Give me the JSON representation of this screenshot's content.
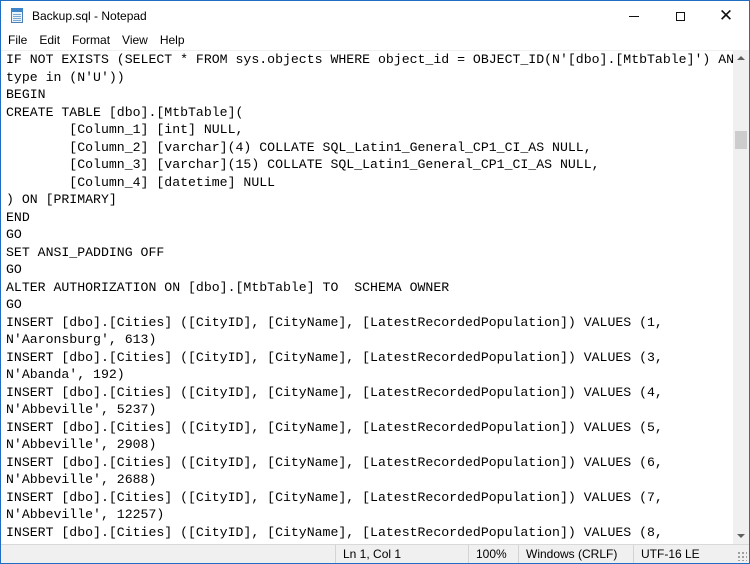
{
  "window": {
    "title": "Backup.sql - Notepad",
    "icon": "notepad-icon",
    "controls": {
      "minimize": "minimize-icon",
      "maximize": "maximize-icon",
      "close": "close-icon"
    }
  },
  "menu": [
    "File",
    "Edit",
    "Format",
    "View",
    "Help"
  ],
  "editor": {
    "lines": [
      "IF NOT EXISTS (SELECT * FROM sys.objects WHERE object_id = OBJECT_ID(N'[dbo].[MtbTable]') AND",
      "type in (N'U'))",
      "BEGIN",
      "CREATE TABLE [dbo].[MtbTable](",
      "        [Column_1] [int] NULL,",
      "        [Column_2] [varchar](4) COLLATE SQL_Latin1_General_CP1_CI_AS NULL,",
      "        [Column_3] [varchar](15) COLLATE SQL_Latin1_General_CP1_CI_AS NULL,",
      "        [Column_4] [datetime] NULL",
      ") ON [PRIMARY]",
      "END",
      "GO",
      "SET ANSI_PADDING OFF",
      "GO",
      "ALTER AUTHORIZATION ON [dbo].[MtbTable] TO  SCHEMA OWNER",
      "GO",
      "INSERT [dbo].[Cities] ([CityID], [CityName], [LatestRecordedPopulation]) VALUES (1,",
      "N'Aaronsburg', 613)",
      "INSERT [dbo].[Cities] ([CityID], [CityName], [LatestRecordedPopulation]) VALUES (3,",
      "N'Abanda', 192)",
      "INSERT [dbo].[Cities] ([CityID], [CityName], [LatestRecordedPopulation]) VALUES (4,",
      "N'Abbeville', 5237)",
      "INSERT [dbo].[Cities] ([CityID], [CityName], [LatestRecordedPopulation]) VALUES (5,",
      "N'Abbeville', 2908)",
      "INSERT [dbo].[Cities] ([CityID], [CityName], [LatestRecordedPopulation]) VALUES (6,",
      "N'Abbeville', 2688)",
      "INSERT [dbo].[Cities] ([CityID], [CityName], [LatestRecordedPopulation]) VALUES (7,",
      "N'Abbeville', 12257)",
      "INSERT [dbo].[Cities] ([CityID], [CityName], [LatestRecordedPopulation]) VALUES (8,"
    ]
  },
  "status": {
    "position": "Ln 1, Col 1",
    "zoom": "100%",
    "line_endings": "Windows (CRLF)",
    "encoding": "UTF-16 LE"
  },
  "colors": {
    "window_border": "#1e6fc4",
    "statusbar_bg": "#f0f0f0"
  }
}
